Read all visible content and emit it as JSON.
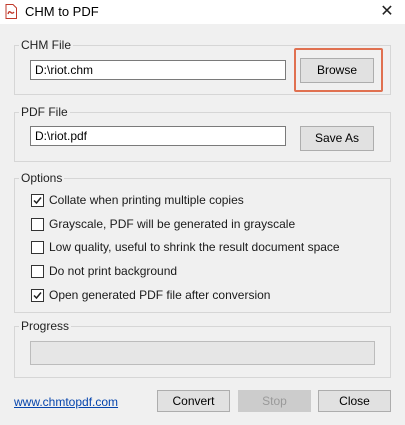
{
  "window": {
    "title": "CHM to PDF",
    "close_glyph": "✕"
  },
  "chm_file": {
    "group_label": "CHM File",
    "value": "D:\\riot.chm",
    "browse_label": "Browse"
  },
  "pdf_file": {
    "group_label": "PDF File",
    "value": "D:\\riot.pdf",
    "save_as_label": "Save As"
  },
  "options": {
    "group_label": "Options",
    "items": [
      {
        "label": "Collate when printing multiple copies",
        "checked": true
      },
      {
        "label": "Grayscale, PDF will be generated in grayscale",
        "checked": false
      },
      {
        "label": "Low quality, useful to shrink the result document space",
        "checked": false
      },
      {
        "label": "Do not print background",
        "checked": false
      },
      {
        "label": "Open generated PDF file after conversion",
        "checked": true
      }
    ]
  },
  "progress": {
    "group_label": "Progress",
    "value": 0
  },
  "footer": {
    "link_text": "www.chmtopdf.com",
    "convert_label": "Convert",
    "stop_label": "Stop",
    "close_label": "Close"
  },
  "colors": {
    "highlight": "#e07050",
    "link": "#0645ad"
  }
}
